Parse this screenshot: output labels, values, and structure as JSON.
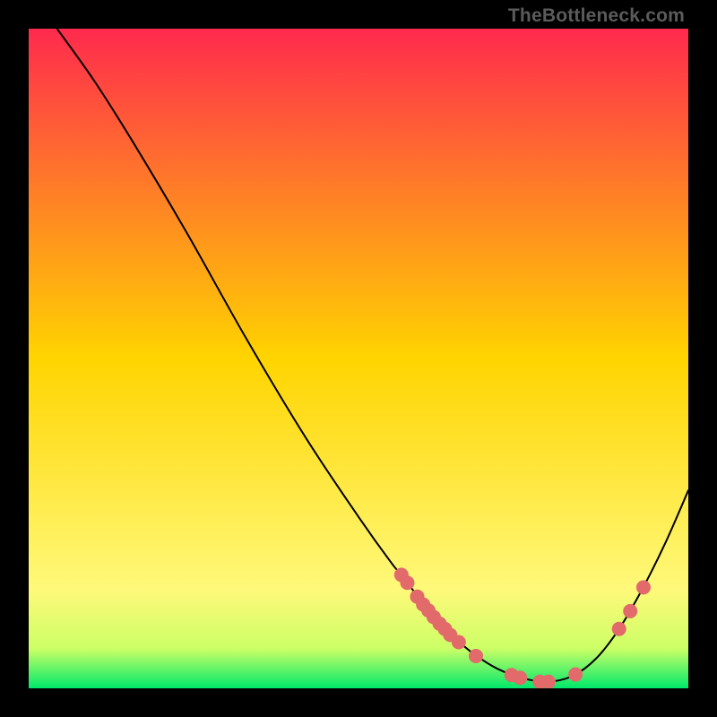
{
  "watermark": "TheBottleneck.com",
  "chart_data": {
    "type": "line",
    "title": "",
    "xlabel": "",
    "ylabel": "",
    "xlim": [
      0,
      100
    ],
    "ylim": [
      0,
      100
    ],
    "background_gradient": {
      "stops": [
        {
          "t": 0.0,
          "color": "#ff2a4d"
        },
        {
          "t": 0.5,
          "color": "#ffd400"
        },
        {
          "t": 0.85,
          "color": "#fff97a"
        },
        {
          "t": 0.94,
          "color": "#ccff66"
        },
        {
          "t": 1.0,
          "color": "#00e86b"
        }
      ]
    },
    "series": [
      {
        "name": "bottleneck-curve",
        "color": "#000000",
        "stroke_width": 2,
        "points": [
          {
            "x": 4.3,
            "y": 100.0
          },
          {
            "x": 10.0,
            "y": 92.0
          },
          {
            "x": 16.0,
            "y": 82.5
          },
          {
            "x": 24.0,
            "y": 69.0
          },
          {
            "x": 33.0,
            "y": 53.0
          },
          {
            "x": 42.0,
            "y": 38.0
          },
          {
            "x": 50.0,
            "y": 26.0
          },
          {
            "x": 55.0,
            "y": 19.0
          },
          {
            "x": 57.0,
            "y": 16.6
          },
          {
            "x": 58.9,
            "y": 14.0
          },
          {
            "x": 60.5,
            "y": 12.0
          },
          {
            "x": 62.5,
            "y": 9.7
          },
          {
            "x": 64.5,
            "y": 7.7
          },
          {
            "x": 67.5,
            "y": 5.2
          },
          {
            "x": 71.0,
            "y": 3.0
          },
          {
            "x": 75.0,
            "y": 1.5
          },
          {
            "x": 78.8,
            "y": 1.0
          },
          {
            "x": 82.5,
            "y": 1.9
          },
          {
            "x": 86.0,
            "y": 4.5
          },
          {
            "x": 89.5,
            "y": 9.0
          },
          {
            "x": 93.0,
            "y": 15.0
          },
          {
            "x": 96.5,
            "y": 22.0
          },
          {
            "x": 100.0,
            "y": 30.0
          }
        ]
      }
    ],
    "markers": {
      "color": "#e26a6a",
      "radius": 8,
      "points": [
        {
          "x": 56.5,
          "y": 17.2
        },
        {
          "x": 57.4,
          "y": 16.0
        },
        {
          "x": 58.9,
          "y": 13.9
        },
        {
          "x": 59.8,
          "y": 12.7
        },
        {
          "x": 60.6,
          "y": 11.8
        },
        {
          "x": 61.4,
          "y": 10.8
        },
        {
          "x": 62.3,
          "y": 9.8
        },
        {
          "x": 63.1,
          "y": 9.0
        },
        {
          "x": 63.9,
          "y": 8.1
        },
        {
          "x": 65.2,
          "y": 7.0
        },
        {
          "x": 67.8,
          "y": 4.9
        },
        {
          "x": 73.2,
          "y": 2.0
        },
        {
          "x": 74.5,
          "y": 1.6
        },
        {
          "x": 77.5,
          "y": 1.0
        },
        {
          "x": 78.8,
          "y": 1.0
        },
        {
          "x": 82.9,
          "y": 2.1
        },
        {
          "x": 89.5,
          "y": 9.0
        },
        {
          "x": 91.2,
          "y": 11.7
        },
        {
          "x": 93.2,
          "y": 15.3
        }
      ]
    }
  }
}
